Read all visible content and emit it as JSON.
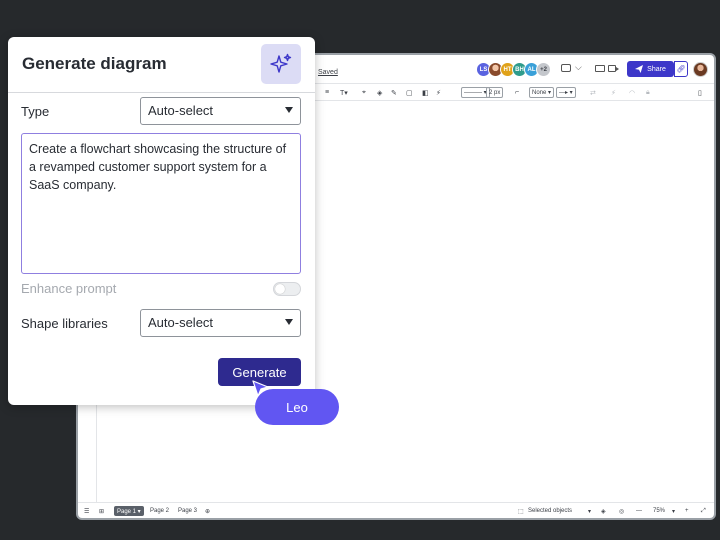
{
  "editor": {
    "saved_label": "Saved",
    "collaborators": [
      {
        "initials": "LS",
        "color": "#5a63e0",
        "photo": false
      },
      {
        "initials": "",
        "color": "#b05a3a",
        "photo": true
      },
      {
        "initials": "HT",
        "color": "#e0a21a",
        "photo": false
      },
      {
        "initials": "BH",
        "color": "#2f9c8c",
        "photo": false
      },
      {
        "initials": "AL",
        "color": "#3aa0d8",
        "photo": false
      },
      {
        "initials": "+2",
        "color": "#c4c7cc",
        "photo": false
      }
    ],
    "share_label": "Share",
    "toolbar": {
      "line_style": "——— ▾",
      "stroke_width": "2 px",
      "arrow_start": "None ▾",
      "arrow_end": "—▸ ▾"
    },
    "bottom": {
      "pages": [
        "Page 1 ▾",
        "Page 2",
        "Page 3"
      ],
      "selected_objects": "Selected objects",
      "zoom": "75%"
    }
  },
  "dialog": {
    "title": "Generate diagram",
    "type_label": "Type",
    "type_value": "Auto-select",
    "prompt_text": "Create a flowchart showcasing the structure of a revamped customer support system for a SaaS company.",
    "enhance_label": "Enhance prompt",
    "enhance_enabled": false,
    "shape_label": "Shape libraries",
    "shape_value": "Auto-select",
    "generate_label": "Generate"
  },
  "cursor": {
    "name": "Leo",
    "color": "#6156f2"
  },
  "colors": {
    "background": "#26292c",
    "accent": "#2e2a8f",
    "share": "#3d37c9"
  }
}
